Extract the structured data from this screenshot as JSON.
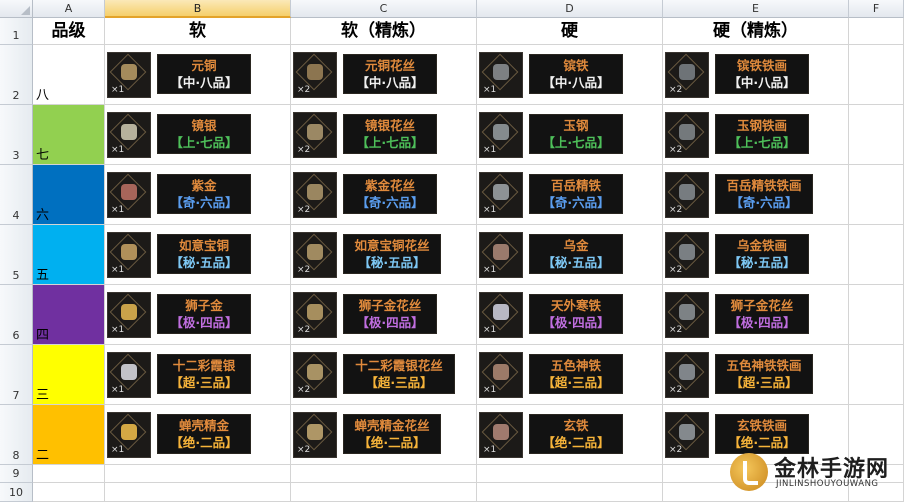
{
  "columns": [
    "A",
    "B",
    "C",
    "D",
    "E",
    "F"
  ],
  "selected_column": "B",
  "rows": [
    "1",
    "2",
    "3",
    "4",
    "5",
    "6",
    "7",
    "8",
    "9",
    "10"
  ],
  "headers": {
    "grade": "品级",
    "soft": "软",
    "soft_refined": "软（精炼）",
    "hard": "硬",
    "hard_refined": "硬（精炼）"
  },
  "grades": [
    {
      "label": "八",
      "color": "#ffffff"
    },
    {
      "label": "七",
      "color": "#92d050"
    },
    {
      "label": "六",
      "color": "#0070c0"
    },
    {
      "label": "五",
      "color": "#00b0f0"
    },
    {
      "label": "四",
      "color": "#7030a0"
    },
    {
      "label": "三",
      "color": "#ffff00"
    },
    {
      "label": "二",
      "color": "#ffc000"
    }
  ],
  "tier_colors": {
    "中": "#f2f2f2",
    "上": "#4ec05a",
    "奇": "#5b9ef0",
    "秘": "#7ec8f5",
    "极": "#c06ee0",
    "超": "#f7b43a",
    "绝": "#f7b43a"
  },
  "items": [
    [
      {
        "name": "元铜",
        "grade": "【中·八品】",
        "qty": "×1",
        "tier": "中",
        "icon": "ore-icon",
        "core": "#a48b5c"
      },
      {
        "name": "元铜花丝",
        "grade": "【中·八品】",
        "qty": "×2",
        "tier": "中",
        "icon": "filigree-icon",
        "core": "#8c7550"
      },
      {
        "name": "镔铁",
        "grade": "【中·八品】",
        "qty": "×1",
        "tier": "中",
        "icon": "ingot-icon",
        "core": "#7d8083"
      },
      {
        "name": "镔铁铁画",
        "grade": "【中·八品】",
        "qty": "×2",
        "tier": "中",
        "icon": "iron-art-icon",
        "core": "#6e7377"
      }
    ],
    [
      {
        "name": "镜银",
        "grade": "【上·七品】",
        "qty": "×1",
        "tier": "上",
        "icon": "ore-icon",
        "core": "#b6b19c"
      },
      {
        "name": "镜银花丝",
        "grade": "【上·七品】",
        "qty": "×2",
        "tier": "上",
        "icon": "filigree-icon",
        "core": "#9b8864"
      },
      {
        "name": "玉钢",
        "grade": "【上·七品】",
        "qty": "×1",
        "tier": "上",
        "icon": "ingot-icon",
        "core": "#858b8e"
      },
      {
        "name": "玉钢铁画",
        "grade": "【上·七品】",
        "qty": "×2",
        "tier": "上",
        "icon": "iron-art-icon",
        "core": "#74797c"
      }
    ],
    [
      {
        "name": "紫金",
        "grade": "【奇·六品】",
        "qty": "×1",
        "tier": "奇",
        "icon": "ore-icon",
        "core": "#a7655a"
      },
      {
        "name": "紫金花丝",
        "grade": "【奇·六品】",
        "qty": "×2",
        "tier": "奇",
        "icon": "filigree-icon",
        "core": "#9a8660"
      },
      {
        "name": "百岳精铁",
        "grade": "【奇·六品】",
        "qty": "×1",
        "tier": "奇",
        "icon": "ingot-icon",
        "core": "#8d9295"
      },
      {
        "name": "百岳精铁铁画",
        "grade": "【奇·六品】",
        "qty": "×2",
        "tier": "奇",
        "icon": "iron-art-icon",
        "core": "#777c80"
      }
    ],
    [
      {
        "name": "如意宝铜",
        "grade": "【秘·五品】",
        "qty": "×1",
        "tier": "秘",
        "icon": "ore-icon",
        "core": "#b0905a"
      },
      {
        "name": "如意宝铜花丝",
        "grade": "【秘·五品】",
        "qty": "×2",
        "tier": "秘",
        "icon": "filigree-icon",
        "core": "#a08a60"
      },
      {
        "name": "乌金",
        "grade": "【秘·五品】",
        "qty": "×1",
        "tier": "秘",
        "icon": "ore-icon",
        "core": "#9a7a6c"
      },
      {
        "name": "乌金铁画",
        "grade": "【秘·五品】",
        "qty": "×2",
        "tier": "秘",
        "icon": "iron-art-icon",
        "core": "#7a7f83"
      }
    ],
    [
      {
        "name": "狮子金",
        "grade": "【极·四品】",
        "qty": "×1",
        "tier": "极",
        "icon": "ore-icon",
        "core": "#c9a24a"
      },
      {
        "name": "狮子金花丝",
        "grade": "【极·四品】",
        "qty": "×2",
        "tier": "极",
        "icon": "filigree-icon",
        "core": "#a68e5e"
      },
      {
        "name": "天外寒铁",
        "grade": "【极·四品】",
        "qty": "×1",
        "tier": "极",
        "icon": "crystal-icon",
        "core": "#b8b8c4"
      },
      {
        "name": "狮子金花丝",
        "grade": "【极·四品】",
        "qty": "×2",
        "tier": "极",
        "icon": "iron-art-icon",
        "core": "#7d8285"
      }
    ],
    [
      {
        "name": "十二彩霞银",
        "grade": "【超·三品】",
        "qty": "×1",
        "tier": "超",
        "icon": "crystal-icon",
        "core": "#c2c2c8"
      },
      {
        "name": "十二彩霞银花丝",
        "grade": "【超·三品】",
        "qty": "×2",
        "tier": "超",
        "icon": "filigree-icon",
        "core": "#a89264"
      },
      {
        "name": "五色神铁",
        "grade": "【超·三品】",
        "qty": "×1",
        "tier": "超",
        "icon": "ore-icon",
        "core": "#9c7a68"
      },
      {
        "name": "五色神铁铁画",
        "grade": "【超·三品】",
        "qty": "×2",
        "tier": "超",
        "icon": "iron-art-icon",
        "core": "#80858a"
      }
    ],
    [
      {
        "name": "蝉壳精金",
        "grade": "【绝·二品】",
        "qty": "×1",
        "tier": "绝",
        "icon": "ore-icon",
        "core": "#d4a844"
      },
      {
        "name": "蝉壳精金花丝",
        "grade": "【绝·二品】",
        "qty": "×2",
        "tier": "绝",
        "icon": "filigree-icon",
        "core": "#ae9666"
      },
      {
        "name": "玄铁",
        "grade": "【绝·二品】",
        "qty": "×1",
        "tier": "绝",
        "icon": "ore-icon",
        "core": "#a07a6e"
      },
      {
        "name": "玄铁铁画",
        "grade": "【绝·二品】",
        "qty": "×2",
        "tier": "绝",
        "icon": "iron-art-icon",
        "core": "#84898d"
      }
    ]
  ],
  "watermark": {
    "title": "金林手游网",
    "subtitle": "JINLINSHOUYOUWANG"
  }
}
